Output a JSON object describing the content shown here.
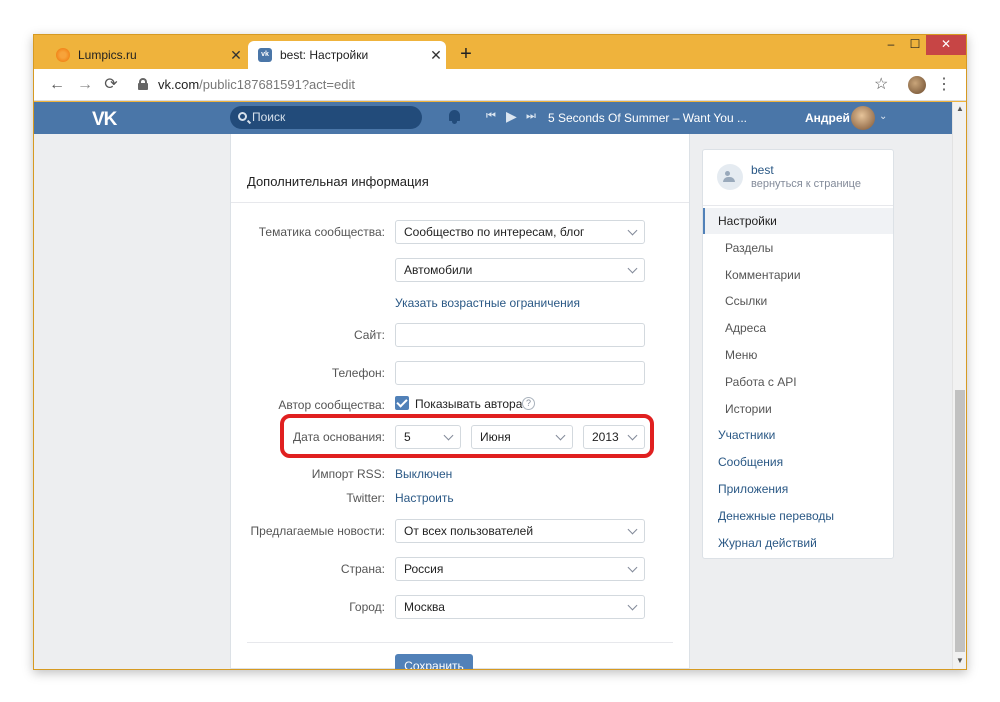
{
  "browser": {
    "tabs": [
      {
        "title": "Lumpics.ru",
        "close": "✕"
      },
      {
        "title": "best: Настройки",
        "close": "✕"
      }
    ],
    "new_tab": "+",
    "window_buttons": {
      "minimize": "–",
      "maximize": "☐",
      "close": "✕"
    },
    "nav": {
      "back": "←",
      "forward": "→",
      "reload": "C"
    },
    "url_host": "vk.com",
    "url_path": "/public187681591?act=edit",
    "star": "☆",
    "menu": "⋮"
  },
  "vk_header": {
    "logo": "VK",
    "search_placeholder": "Поиск",
    "player": {
      "prev": "⏮",
      "play": "▶",
      "next": "⏭"
    },
    "track": "5 Seconds Of Summer – Want You ...",
    "user_name": "Андрей",
    "chevron": "⌄"
  },
  "section": {
    "title": "Дополнительная информация"
  },
  "form": {
    "theme_label": "Тематика сообщества:",
    "theme_value": "Сообщество по интересам, блог",
    "subtheme_value": "Автомобили",
    "age_link": "Указать возрастные ограничения",
    "site_label": "Сайт:",
    "phone_label": "Телефон:",
    "author_label": "Автор сообщества:",
    "author_check": "Показывать автора",
    "help": "?",
    "founded_label": "Дата основания:",
    "founded_day": "5",
    "founded_month": "Июня",
    "founded_year": "2013",
    "rss_label": "Импорт RSS:",
    "rss_value": "Выключен",
    "twitter_label": "Twitter:",
    "twitter_value": "Настроить",
    "suggest_label": "Предлагаемые новости:",
    "suggest_value": "От всех пользователей",
    "country_label": "Страна:",
    "country_value": "Россия",
    "city_label": "Город:",
    "city_value": "Москва",
    "save": "Сохранить"
  },
  "side_menu": {
    "group_name": "best",
    "back_link": "вернуться к странице",
    "items": [
      {
        "label": "Настройки",
        "kind": "active"
      },
      {
        "label": "Разделы",
        "kind": "sub"
      },
      {
        "label": "Комментарии",
        "kind": "sub"
      },
      {
        "label": "Ссылки",
        "kind": "sub"
      },
      {
        "label": "Адреса",
        "kind": "sub"
      },
      {
        "label": "Меню",
        "kind": "sub"
      },
      {
        "label": "Работа с API",
        "kind": "sub"
      },
      {
        "label": "Истории",
        "kind": "sub"
      },
      {
        "label": "Участники",
        "kind": "top"
      },
      {
        "label": "Сообщения",
        "kind": "top"
      },
      {
        "label": "Приложения",
        "kind": "top"
      },
      {
        "label": "Денежные переводы",
        "kind": "top"
      },
      {
        "label": "Журнал действий",
        "kind": "top"
      }
    ]
  },
  "colors": {
    "accent": "#4a76a8",
    "button": "#5181b8",
    "link": "#2a5885",
    "highlight": "#e02020",
    "frame": "#efb33c"
  }
}
